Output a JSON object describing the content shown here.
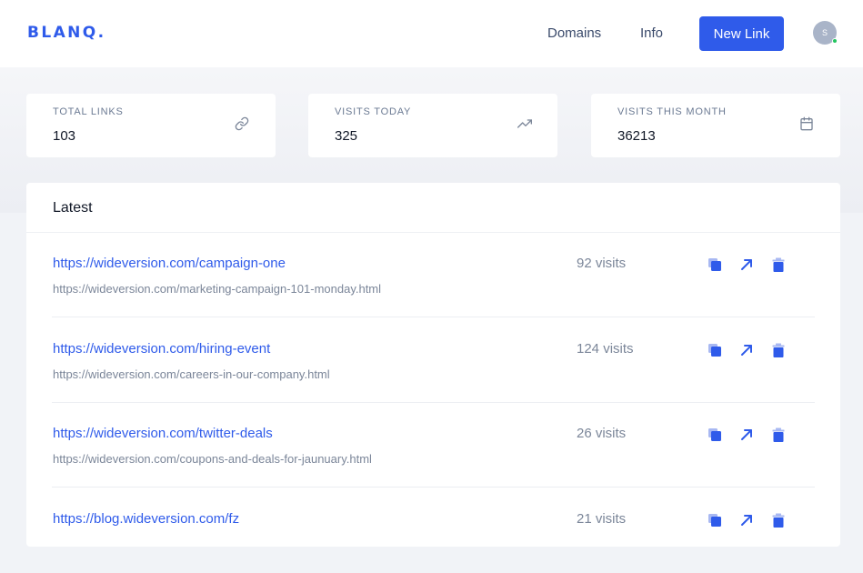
{
  "header": {
    "logo": "BLANQ.",
    "nav": [
      "Domains",
      "Info"
    ],
    "new_link": "New Link",
    "avatar_initial": "S"
  },
  "stats": [
    {
      "label": "TOTAL LINKS",
      "value": "103",
      "icon": "link-icon"
    },
    {
      "label": "VISITS TODAY",
      "value": "325",
      "icon": "trending-up-icon"
    },
    {
      "label": "VISITS THIS MONTH",
      "value": "36213",
      "icon": "calendar-icon"
    }
  ],
  "latest": {
    "title": "Latest",
    "rows": [
      {
        "short": "https://wideversion.com/campaign-one",
        "long": "https://wideversion.com/marketing-campaign-101-monday.html",
        "visits": "92 visits"
      },
      {
        "short": "https://wideversion.com/hiring-event",
        "long": "https://wideversion.com/careers-in-our-company.html",
        "visits": "124 visits"
      },
      {
        "short": "https://wideversion.com/twitter-deals",
        "long": "https://wideversion.com/coupons-and-deals-for-jaunuary.html",
        "visits": "26 visits"
      },
      {
        "short": "https://blog.wideversion.com/fz",
        "long": "",
        "visits": "21 visits"
      }
    ]
  },
  "colors": {
    "accent": "#2f5bea",
    "muted_text": "#7b8699",
    "online_status": "#22c55e"
  }
}
